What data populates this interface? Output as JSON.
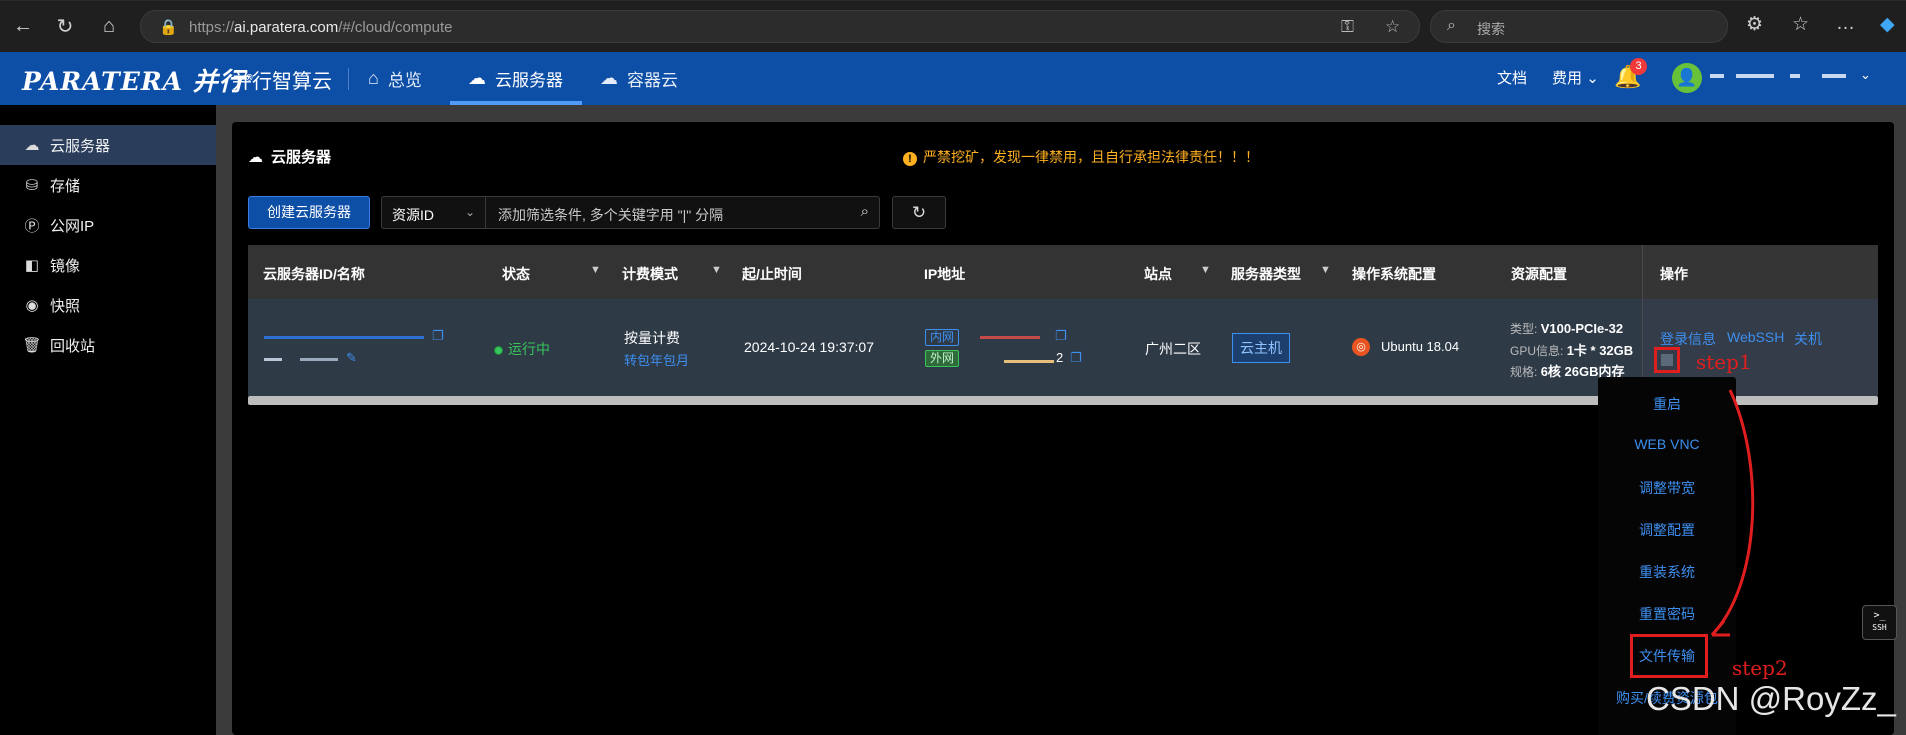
{
  "browser": {
    "url_prefix": "https://",
    "url_host": "ai.paratera.com",
    "url_path": "/#/cloud/compute",
    "search_placeholder": "搜索"
  },
  "header": {
    "logo_text": "PARATERA 并行",
    "logo_sub": "并行智算云",
    "nav": [
      {
        "label": "总览"
      },
      {
        "label": "云服务器"
      },
      {
        "label": "容器云"
      }
    ],
    "docs_label": "文档",
    "fees_label": "费用",
    "notification_count": "3"
  },
  "sidebar": {
    "items": [
      {
        "label": "云服务器"
      },
      {
        "label": "存储"
      },
      {
        "label": "公网IP"
      },
      {
        "label": "镜像"
      },
      {
        "label": "快照"
      },
      {
        "label": "回收站"
      }
    ]
  },
  "main": {
    "title": "云服务器",
    "warning": "严禁挖矿，发现一律禁用，且自行承担法律责任！！！",
    "create_button": "创建云服务器",
    "filter_select": "资源ID",
    "filter_placeholder": "添加筛选条件, 多个关键字用 \"|\" 分隔"
  },
  "table": {
    "headers": {
      "id_name": "云服务器ID/名称",
      "status": "状态",
      "billing": "计费模式",
      "time": "起/止时间",
      "ip": "IP地址",
      "site": "站点",
      "server_type": "服务器类型",
      "os": "操作系统配置",
      "resources": "资源配置",
      "ops": "操作"
    },
    "row": {
      "status": "运行中",
      "billing": "按量计费",
      "billing_link": "转包年包月",
      "time": "2024-10-24 19:37:07",
      "ip_inner_tag": "内网",
      "ip_outer_tag": "外网",
      "ip_outer_suffix": "2",
      "site": "广州二区",
      "server_type": "云主机",
      "os": "Ubuntu 18.04",
      "res_type_label": "类型:",
      "res_type_value": "V100-PCIe-32",
      "res_gpu_label": "GPU信息:",
      "res_gpu_value": "1卡 * 32GB",
      "res_spec_label": "规格:",
      "res_spec_value": "6核 26GB内存",
      "op_login": "登录信息",
      "op_webssh": "WebSSH",
      "op_shutdown": "关机"
    }
  },
  "dropdown": {
    "items": [
      {
        "label": "重启"
      },
      {
        "label": "WEB VNC"
      },
      {
        "label": "调整带宽"
      },
      {
        "label": "调整配置"
      },
      {
        "label": "重装系统"
      },
      {
        "label": "重置密码"
      },
      {
        "label": "文件传输"
      },
      {
        "label": "购买/续费资源包"
      }
    ]
  },
  "annotations": {
    "step1": "step1",
    "step2": "step2"
  },
  "ssh_button": {
    "line1": ">_",
    "line2": "SSH"
  },
  "watermark": "CSDN @RoyZz_",
  "colors": {
    "brand": "#0d4ea7",
    "link": "#3d8ff0",
    "running": "#37c45a",
    "warning": "#ffb020",
    "annotation": "#e01e1e"
  }
}
